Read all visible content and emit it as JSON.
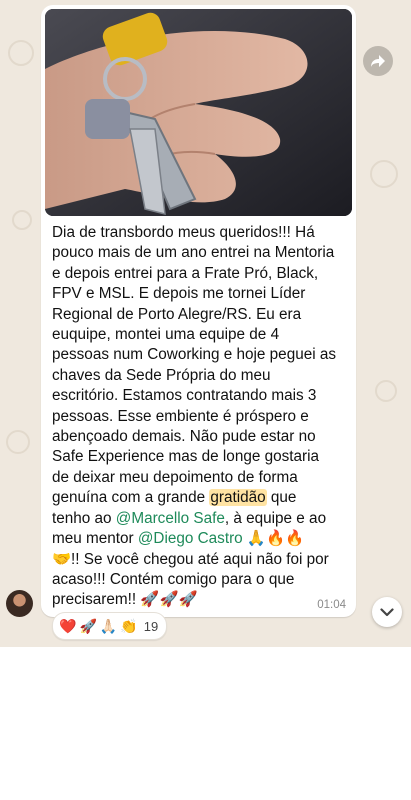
{
  "message": {
    "lines": [
      "Dia de transbordo meus queridos!!! Há",
      "pouco mais de um ano entrei na Mentoria",
      "e depois entrei para a Frate Pró, Black,",
      "FPV e MSL. E depois me tornei Líder",
      "Regional de Porto Alegre/RS. Eu era",
      "euquipe, montei uma equipe de 4",
      "pessoas num Coworking e hoje peguei as",
      "chaves da Sede Própria do meu",
      "escritório. Estamos contratando mais 3",
      "pessoas. Esse embiente é próspero e",
      "abençoado demais. Não pude estar no",
      "Safe Experience mas de longe gostaria",
      "de deixar meu depoimento de forma"
    ],
    "line14_pre": "genuína com a grande ",
    "line14_hl": "gratidão",
    "line14_post": " que",
    "line15_pre": "tenho ao ",
    "mention1": "@Marcello Safe",
    "line15_post": ", à equipe e ao",
    "line16_pre": "meu mentor ",
    "mention2": "@Diego Castro",
    "line16_emoji": " 🙏🔥🔥",
    "line17": "🤝!! Se você chegou até aqui não foi por",
    "line18": "acaso!!! Contém comigo para o que",
    "line19": "precisarem!! 🚀🚀🚀",
    "time": "01:04"
  },
  "reactions": {
    "emojis": [
      "❤️",
      "🚀",
      "🙏🏻",
      "👏"
    ],
    "count": "19"
  },
  "icons": {
    "share": "forward-arrow-icon",
    "scroll": "chevron-down-icon"
  },
  "colors": {
    "mention": "#1e8a5a",
    "highlight": "#ffe3a3",
    "background": "#efe8de"
  }
}
